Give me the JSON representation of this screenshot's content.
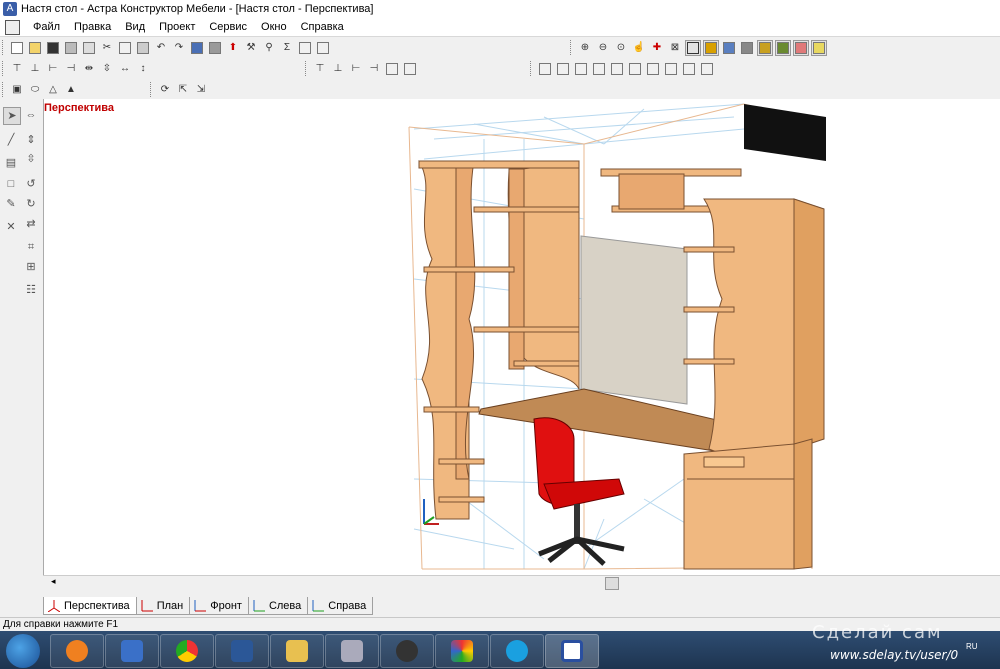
{
  "window": {
    "title": "Настя стол - Астра Конструктор Мебели - [Настя стол - Перспектива]"
  },
  "menu": [
    "Файл",
    "Правка",
    "Вид",
    "Проект",
    "Сервис",
    "Окно",
    "Справка"
  ],
  "view": {
    "title": "Перспектива"
  },
  "tabs": [
    {
      "label": "Перспектива",
      "active": true
    },
    {
      "label": "План",
      "active": false
    },
    {
      "label": "Фронт",
      "active": false
    },
    {
      "label": "Слева",
      "active": false
    },
    {
      "label": "Справа",
      "active": false
    }
  ],
  "statusbar": {
    "text": "Для справки нажмите F1"
  },
  "taskbar": {
    "apps": [
      "windows-media-player-icon",
      "audio-player-icon",
      "chrome-icon",
      "word-icon",
      "file-explorer-icon",
      "calculator-icon",
      "flash-icon",
      "paint-icon",
      "skype-icon",
      "astra-furniture-icon"
    ]
  },
  "watermark": {
    "brand": "Сделай сам",
    "url": "www.sdelay.tv/user/0",
    "ru": "RU"
  },
  "colors": {
    "panel_wood": "#f0b880",
    "chair_red": "#e01010",
    "view_title": "#c00000"
  }
}
